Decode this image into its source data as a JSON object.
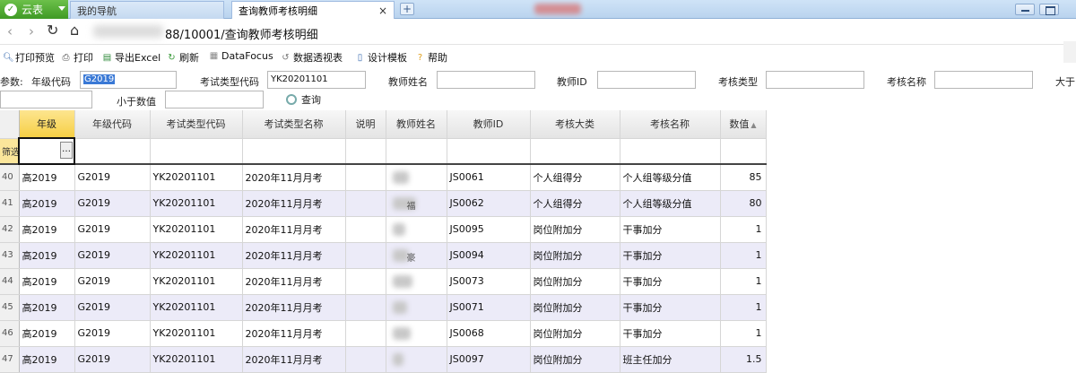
{
  "browser": {
    "app_name": "云表",
    "tabs": [
      {
        "label": "我的导航"
      },
      {
        "label": "查询教师考核明细"
      }
    ],
    "address": "88/10001/查询教师考核明细"
  },
  "toolbar": {
    "print_preview": "打印预览",
    "print": "打印",
    "export_excel": "导出Excel",
    "refresh": "刷新",
    "datafocus": "DataFocus",
    "pivot": "数据透视表",
    "design_template": "设计模板",
    "help": "帮助"
  },
  "params": {
    "prefix": "参数:",
    "grade_code_label": "年级代码",
    "grade_code_value": "G2019",
    "exam_type_code_label": "考试类型代码",
    "exam_type_code_value": "YK20201101",
    "teacher_name_label": "教师姓名",
    "teacher_id_label": "教师ID",
    "assess_type_label": "考核类型",
    "assess_name_label": "考核名称",
    "greater_than_label": "大于",
    "less_than_label": "小于数值",
    "query_button": "查询"
  },
  "grid": {
    "columns": [
      "年级",
      "年级代码",
      "考试类型代码",
      "考试类型名称",
      "说明",
      "教师姓名",
      "教师ID",
      "考核大类",
      "考核名称",
      "数值"
    ],
    "filter_row_label": "筛选",
    "rows": [
      {
        "n": "40",
        "grade": "高2019",
        "grade_code": "G2019",
        "exam_code": "YK20201101",
        "exam_name": "2020年11月月考",
        "note": "",
        "tail": "",
        "tid": "JS0061",
        "cat": "个人组得分",
        "aname": "个人组等级分值",
        "val": "85"
      },
      {
        "n": "41",
        "grade": "高2019",
        "grade_code": "G2019",
        "exam_code": "YK20201101",
        "exam_name": "2020年11月月考",
        "note": "",
        "tail": "福",
        "tid": "JS0062",
        "cat": "个人组得分",
        "aname": "个人组等级分值",
        "val": "80"
      },
      {
        "n": "42",
        "grade": "高2019",
        "grade_code": "G2019",
        "exam_code": "YK20201101",
        "exam_name": "2020年11月月考",
        "note": "",
        "tail": "",
        "tid": "JS0095",
        "cat": "岗位附加分",
        "aname": "干事加分",
        "val": "1"
      },
      {
        "n": "43",
        "grade": "高2019",
        "grade_code": "G2019",
        "exam_code": "YK20201101",
        "exam_name": "2020年11月月考",
        "note": "",
        "tail": "豪",
        "tid": "JS0094",
        "cat": "岗位附加分",
        "aname": "干事加分",
        "val": "1"
      },
      {
        "n": "44",
        "grade": "高2019",
        "grade_code": "G2019",
        "exam_code": "YK20201101",
        "exam_name": "2020年11月月考",
        "note": "",
        "tail": "",
        "tid": "JS0073",
        "cat": "岗位附加分",
        "aname": "干事加分",
        "val": "1"
      },
      {
        "n": "45",
        "grade": "高2019",
        "grade_code": "G2019",
        "exam_code": "YK20201101",
        "exam_name": "2020年11月月考",
        "note": "",
        "tail": "",
        "tid": "JS0071",
        "cat": "岗位附加分",
        "aname": "干事加分",
        "val": "1"
      },
      {
        "n": "46",
        "grade": "高2019",
        "grade_code": "G2019",
        "exam_code": "YK20201101",
        "exam_name": "2020年11月月考",
        "note": "",
        "tail": "",
        "tid": "JS0068",
        "cat": "岗位附加分",
        "aname": "干事加分",
        "val": "1"
      },
      {
        "n": "47",
        "grade": "高2019",
        "grade_code": "G2019",
        "exam_code": "YK20201101",
        "exam_name": "2020年11月月考",
        "note": "",
        "tail": "",
        "tid": "JS0097",
        "cat": "岗位附加分",
        "aname": "班主任加分",
        "val": "1.5"
      }
    ]
  }
}
